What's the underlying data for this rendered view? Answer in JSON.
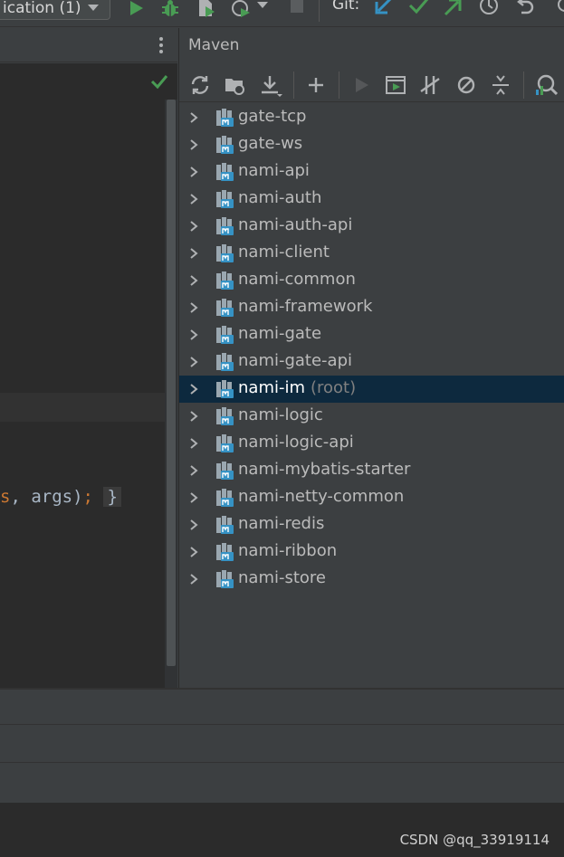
{
  "toolbar": {
    "run_config_label": "ication (1)",
    "git_label": "Git:"
  },
  "editor": {
    "code_fragment_a": "s",
    "code_fragment_b": ", args)",
    "code_fragment_c": ";",
    "code_fragment_d": "}"
  },
  "maven": {
    "title": "Maven",
    "modules": [
      {
        "name": "gate-tcp"
      },
      {
        "name": "gate-ws"
      },
      {
        "name": "nami-api"
      },
      {
        "name": "nami-auth"
      },
      {
        "name": "nami-auth-api"
      },
      {
        "name": "nami-client"
      },
      {
        "name": "nami-common"
      },
      {
        "name": "nami-framework"
      },
      {
        "name": "nami-gate"
      },
      {
        "name": "nami-gate-api"
      },
      {
        "name": "nami-im",
        "suffix": "(root)",
        "selected": true
      },
      {
        "name": "nami-logic"
      },
      {
        "name": "nami-logic-api"
      },
      {
        "name": "nami-mybatis-starter"
      },
      {
        "name": "nami-netty-common"
      },
      {
        "name": "nami-redis"
      },
      {
        "name": "nami-ribbon"
      },
      {
        "name": "nami-store"
      }
    ]
  },
  "watermark": "CSDN @qq_33919114",
  "colors": {
    "run_green": "#499c54",
    "git_blue": "#3592c4",
    "selection": "#0d293e"
  }
}
